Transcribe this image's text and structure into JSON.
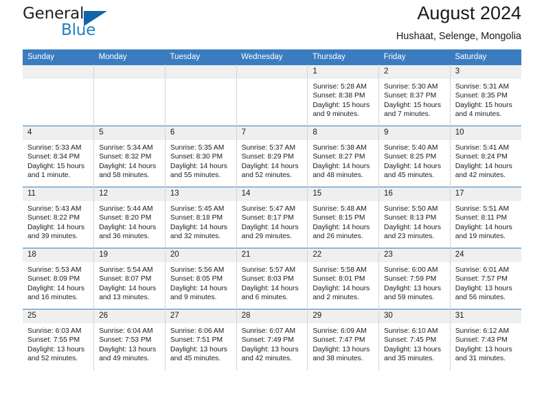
{
  "brand": {
    "name_part1": "General",
    "name_part2": "Blue",
    "triangle_color": "#1064a8",
    "blue_color": "#1f7ec2"
  },
  "header": {
    "title": "August 2024",
    "subtitle": "Hushaat, Selenge, Mongolia"
  },
  "calendar": {
    "header_bg": "#3a7cbf",
    "daynum_bg": "#efefef",
    "weekday_headers": [
      "Sunday",
      "Monday",
      "Tuesday",
      "Wednesday",
      "Thursday",
      "Friday",
      "Saturday"
    ],
    "weeks": [
      [
        {
          "day": "",
          "empty": true,
          "sunrise": "",
          "sunset": "",
          "daylight1": "",
          "daylight2": ""
        },
        {
          "day": "",
          "empty": true,
          "sunrise": "",
          "sunset": "",
          "daylight1": "",
          "daylight2": ""
        },
        {
          "day": "",
          "empty": true,
          "sunrise": "",
          "sunset": "",
          "daylight1": "",
          "daylight2": ""
        },
        {
          "day": "",
          "empty": true,
          "sunrise": "",
          "sunset": "",
          "daylight1": "",
          "daylight2": ""
        },
        {
          "day": "1",
          "empty": false,
          "sunrise": "Sunrise: 5:28 AM",
          "sunset": "Sunset: 8:38 PM",
          "daylight1": "Daylight: 15 hours",
          "daylight2": "and 9 minutes."
        },
        {
          "day": "2",
          "empty": false,
          "sunrise": "Sunrise: 5:30 AM",
          "sunset": "Sunset: 8:37 PM",
          "daylight1": "Daylight: 15 hours",
          "daylight2": "and 7 minutes."
        },
        {
          "day": "3",
          "empty": false,
          "sunrise": "Sunrise: 5:31 AM",
          "sunset": "Sunset: 8:35 PM",
          "daylight1": "Daylight: 15 hours",
          "daylight2": "and 4 minutes."
        }
      ],
      [
        {
          "day": "4",
          "empty": false,
          "sunrise": "Sunrise: 5:33 AM",
          "sunset": "Sunset: 8:34 PM",
          "daylight1": "Daylight: 15 hours",
          "daylight2": "and 1 minute."
        },
        {
          "day": "5",
          "empty": false,
          "sunrise": "Sunrise: 5:34 AM",
          "sunset": "Sunset: 8:32 PM",
          "daylight1": "Daylight: 14 hours",
          "daylight2": "and 58 minutes."
        },
        {
          "day": "6",
          "empty": false,
          "sunrise": "Sunrise: 5:35 AM",
          "sunset": "Sunset: 8:30 PM",
          "daylight1": "Daylight: 14 hours",
          "daylight2": "and 55 minutes."
        },
        {
          "day": "7",
          "empty": false,
          "sunrise": "Sunrise: 5:37 AM",
          "sunset": "Sunset: 8:29 PM",
          "daylight1": "Daylight: 14 hours",
          "daylight2": "and 52 minutes."
        },
        {
          "day": "8",
          "empty": false,
          "sunrise": "Sunrise: 5:38 AM",
          "sunset": "Sunset: 8:27 PM",
          "daylight1": "Daylight: 14 hours",
          "daylight2": "and 48 minutes."
        },
        {
          "day": "9",
          "empty": false,
          "sunrise": "Sunrise: 5:40 AM",
          "sunset": "Sunset: 8:25 PM",
          "daylight1": "Daylight: 14 hours",
          "daylight2": "and 45 minutes."
        },
        {
          "day": "10",
          "empty": false,
          "sunrise": "Sunrise: 5:41 AM",
          "sunset": "Sunset: 8:24 PM",
          "daylight1": "Daylight: 14 hours",
          "daylight2": "and 42 minutes."
        }
      ],
      [
        {
          "day": "11",
          "empty": false,
          "sunrise": "Sunrise: 5:43 AM",
          "sunset": "Sunset: 8:22 PM",
          "daylight1": "Daylight: 14 hours",
          "daylight2": "and 39 minutes."
        },
        {
          "day": "12",
          "empty": false,
          "sunrise": "Sunrise: 5:44 AM",
          "sunset": "Sunset: 8:20 PM",
          "daylight1": "Daylight: 14 hours",
          "daylight2": "and 36 minutes."
        },
        {
          "day": "13",
          "empty": false,
          "sunrise": "Sunrise: 5:45 AM",
          "sunset": "Sunset: 8:18 PM",
          "daylight1": "Daylight: 14 hours",
          "daylight2": "and 32 minutes."
        },
        {
          "day": "14",
          "empty": false,
          "sunrise": "Sunrise: 5:47 AM",
          "sunset": "Sunset: 8:17 PM",
          "daylight1": "Daylight: 14 hours",
          "daylight2": "and 29 minutes."
        },
        {
          "day": "15",
          "empty": false,
          "sunrise": "Sunrise: 5:48 AM",
          "sunset": "Sunset: 8:15 PM",
          "daylight1": "Daylight: 14 hours",
          "daylight2": "and 26 minutes."
        },
        {
          "day": "16",
          "empty": false,
          "sunrise": "Sunrise: 5:50 AM",
          "sunset": "Sunset: 8:13 PM",
          "daylight1": "Daylight: 14 hours",
          "daylight2": "and 23 minutes."
        },
        {
          "day": "17",
          "empty": false,
          "sunrise": "Sunrise: 5:51 AM",
          "sunset": "Sunset: 8:11 PM",
          "daylight1": "Daylight: 14 hours",
          "daylight2": "and 19 minutes."
        }
      ],
      [
        {
          "day": "18",
          "empty": false,
          "sunrise": "Sunrise: 5:53 AM",
          "sunset": "Sunset: 8:09 PM",
          "daylight1": "Daylight: 14 hours",
          "daylight2": "and 16 minutes."
        },
        {
          "day": "19",
          "empty": false,
          "sunrise": "Sunrise: 5:54 AM",
          "sunset": "Sunset: 8:07 PM",
          "daylight1": "Daylight: 14 hours",
          "daylight2": "and 13 minutes."
        },
        {
          "day": "20",
          "empty": false,
          "sunrise": "Sunrise: 5:56 AM",
          "sunset": "Sunset: 8:05 PM",
          "daylight1": "Daylight: 14 hours",
          "daylight2": "and 9 minutes."
        },
        {
          "day": "21",
          "empty": false,
          "sunrise": "Sunrise: 5:57 AM",
          "sunset": "Sunset: 8:03 PM",
          "daylight1": "Daylight: 14 hours",
          "daylight2": "and 6 minutes."
        },
        {
          "day": "22",
          "empty": false,
          "sunrise": "Sunrise: 5:58 AM",
          "sunset": "Sunset: 8:01 PM",
          "daylight1": "Daylight: 14 hours",
          "daylight2": "and 2 minutes."
        },
        {
          "day": "23",
          "empty": false,
          "sunrise": "Sunrise: 6:00 AM",
          "sunset": "Sunset: 7:59 PM",
          "daylight1": "Daylight: 13 hours",
          "daylight2": "and 59 minutes."
        },
        {
          "day": "24",
          "empty": false,
          "sunrise": "Sunrise: 6:01 AM",
          "sunset": "Sunset: 7:57 PM",
          "daylight1": "Daylight: 13 hours",
          "daylight2": "and 56 minutes."
        }
      ],
      [
        {
          "day": "25",
          "empty": false,
          "sunrise": "Sunrise: 6:03 AM",
          "sunset": "Sunset: 7:55 PM",
          "daylight1": "Daylight: 13 hours",
          "daylight2": "and 52 minutes."
        },
        {
          "day": "26",
          "empty": false,
          "sunrise": "Sunrise: 6:04 AM",
          "sunset": "Sunset: 7:53 PM",
          "daylight1": "Daylight: 13 hours",
          "daylight2": "and 49 minutes."
        },
        {
          "day": "27",
          "empty": false,
          "sunrise": "Sunrise: 6:06 AM",
          "sunset": "Sunset: 7:51 PM",
          "daylight1": "Daylight: 13 hours",
          "daylight2": "and 45 minutes."
        },
        {
          "day": "28",
          "empty": false,
          "sunrise": "Sunrise: 6:07 AM",
          "sunset": "Sunset: 7:49 PM",
          "daylight1": "Daylight: 13 hours",
          "daylight2": "and 42 minutes."
        },
        {
          "day": "29",
          "empty": false,
          "sunrise": "Sunrise: 6:09 AM",
          "sunset": "Sunset: 7:47 PM",
          "daylight1": "Daylight: 13 hours",
          "daylight2": "and 38 minutes."
        },
        {
          "day": "30",
          "empty": false,
          "sunrise": "Sunrise: 6:10 AM",
          "sunset": "Sunset: 7:45 PM",
          "daylight1": "Daylight: 13 hours",
          "daylight2": "and 35 minutes."
        },
        {
          "day": "31",
          "empty": false,
          "sunrise": "Sunrise: 6:12 AM",
          "sunset": "Sunset: 7:43 PM",
          "daylight1": "Daylight: 13 hours",
          "daylight2": "and 31 minutes."
        }
      ]
    ]
  }
}
